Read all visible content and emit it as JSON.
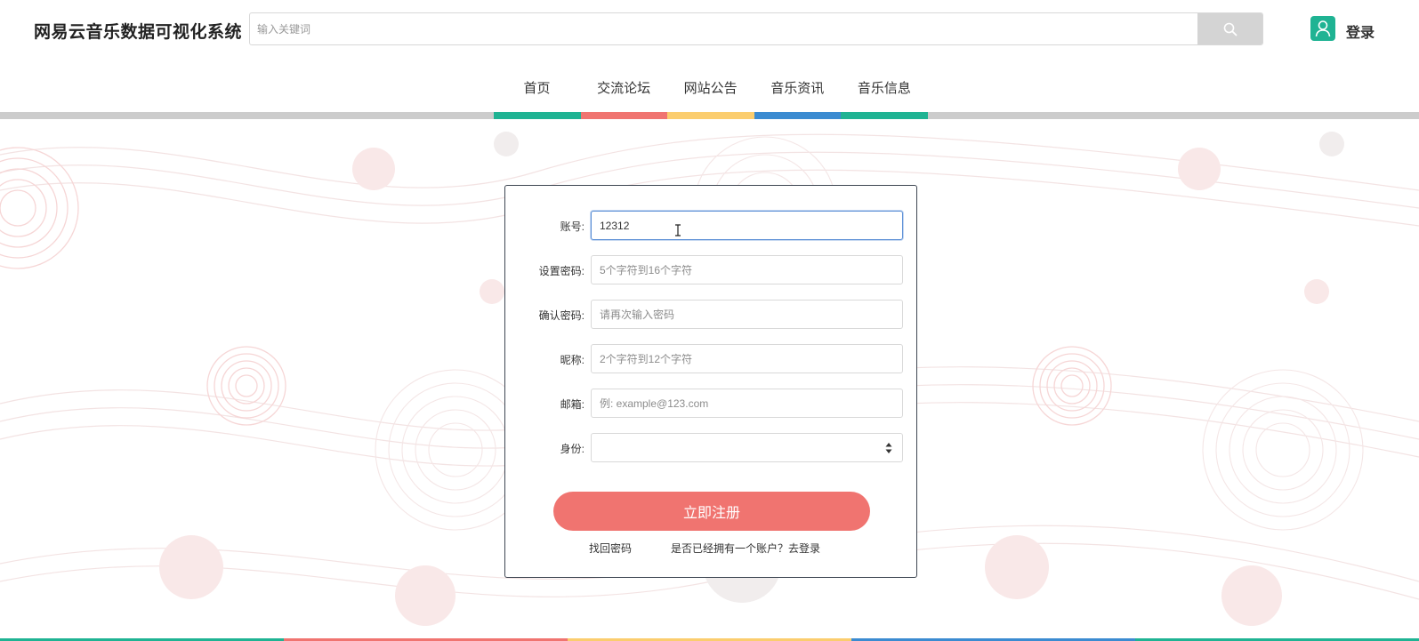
{
  "header": {
    "site_title": "网易云音乐数据可视化系统",
    "search_placeholder": "输入关键词",
    "login_label": "登录"
  },
  "nav": {
    "items": [
      {
        "label": "首页",
        "color": "#1fb393"
      },
      {
        "label": "交流论坛",
        "color": "#f07470"
      },
      {
        "label": "网站公告",
        "color": "#fbcd6e"
      },
      {
        "label": "音乐资讯",
        "color": "#3b8bd1"
      },
      {
        "label": "音乐信息",
        "color": "#1fb393"
      }
    ]
  },
  "form": {
    "account_label": "账号:",
    "account_value": "12312",
    "password_label": "设置密码:",
    "password_placeholder": "5个字符到16个字符",
    "confirm_label": "确认密码:",
    "confirm_placeholder": "请再次输入密码",
    "nickname_label": "昵称:",
    "nickname_placeholder": "2个字符到12个字符",
    "email_label": "邮箱:",
    "email_placeholder": "例: example@123.com",
    "role_label": "身份:",
    "role_value": "",
    "register_button": "立即注册",
    "forgot_password": "找回密码",
    "have_account": "是否已经拥有一个账户？去登录"
  },
  "colors": {
    "accent_green": "#1fb393",
    "accent_red": "#f07470",
    "accent_yellow": "#fbcd6e",
    "accent_blue": "#3b8bd1",
    "search_button": "#d4d4d4"
  },
  "icons": {
    "search": "search-icon",
    "user": "user-icon",
    "select": "select-arrows-icon"
  }
}
